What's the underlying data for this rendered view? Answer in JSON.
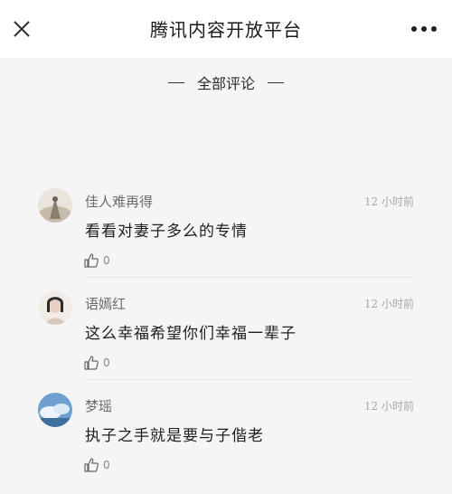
{
  "header": {
    "title": "腾讯内容开放平台",
    "close_icon": "close-icon",
    "more_icon": "more-icon"
  },
  "section": {
    "title": "全部评论"
  },
  "comments": [
    {
      "username": "佳人难再得",
      "time": "12 小时前",
      "content": "看看对妻子多么的专情",
      "likes": "0",
      "avatar_colors": [
        "#e9e4dc",
        "#c6bba8",
        "#8a7f70"
      ]
    },
    {
      "username": "语嫣红",
      "time": "12 小时前",
      "content": "这么幸福希望你们幸福一辈子",
      "likes": "0",
      "avatar_colors": [
        "#f2ece6",
        "#e8cfc3",
        "#2a2a2a"
      ]
    },
    {
      "username": "梦瑶",
      "time": "12 小时前",
      "content": "执子之手就是要与子偕老",
      "likes": "0",
      "avatar_colors": [
        "#b9d4ee",
        "#6f9fcf",
        "#eef4fb"
      ]
    }
  ]
}
